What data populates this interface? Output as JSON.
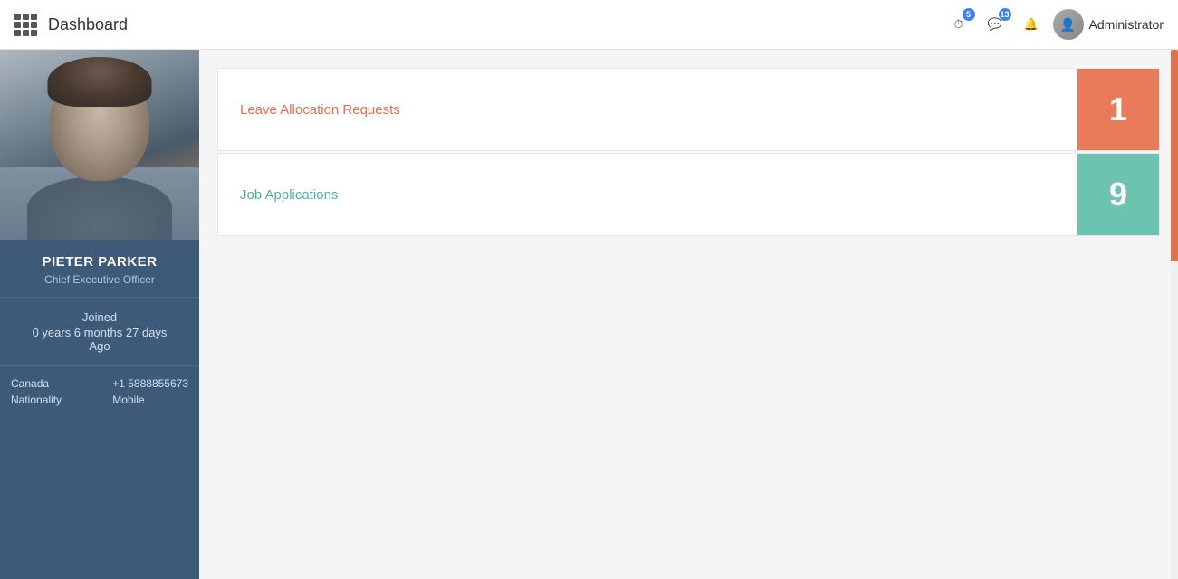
{
  "header": {
    "title": "Dashboard",
    "icons": {
      "clock_badge": "5",
      "chat_badge": "13"
    },
    "admin_name": "Administrator"
  },
  "sidebar": {
    "profile_name": "PIETER PARKER",
    "profile_title": "Chief Executive Officer",
    "joined_label": "Joined",
    "joined_duration": "0 years 6 months 27 days",
    "joined_ago": "Ago",
    "nationality_label": "Canada",
    "nationality_sub": "Nationality",
    "phone_value": "+1 5888855673",
    "phone_sub": "Mobile"
  },
  "dashboard": {
    "card1_label": "Leave Allocation Requests",
    "card1_value": "1",
    "card2_label": "Job Applications",
    "card2_value": "9"
  }
}
